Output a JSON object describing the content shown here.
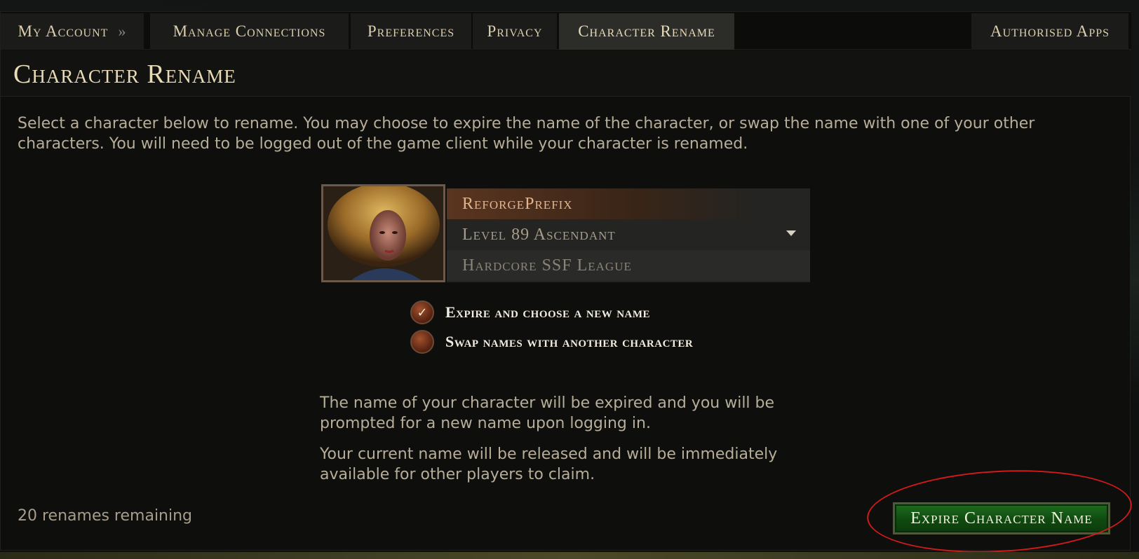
{
  "nav": {
    "my_account": "My Account",
    "separator": "»",
    "tabs": [
      {
        "label": "Manage Connections"
      },
      {
        "label": "Preferences"
      },
      {
        "label": "Privacy"
      },
      {
        "label": "Character Rename"
      },
      {
        "label": "Authorised Apps"
      }
    ],
    "active_tab": "Character Rename"
  },
  "page": {
    "title": "Character Rename",
    "intro": "Select a character below to rename. You may choose to expire the name of the character, or swap the name with one of your other characters. You will need to be logged out of the game client while your character is renamed."
  },
  "character": {
    "name": "ReforgePrefix",
    "level_class": "Level 89 Ascendant",
    "league": "Hardcore SSF League"
  },
  "options": [
    {
      "label": "Expire and choose a new name",
      "selected": true
    },
    {
      "label": "Swap names with another character",
      "selected": false
    }
  ],
  "description": [
    "The name of your character will be expired and you will be prompted for a new name upon logging in.",
    "Your current name will be released and will be immediately available for other players to claim."
  ],
  "footer": {
    "renames_remaining": "20 renames remaining",
    "expire_button": "Expire Character Name"
  },
  "colors": {
    "accent_gold": "#e8dbb6",
    "button_green": "#1f6d1f",
    "annotation_red": "#d11a1a"
  }
}
